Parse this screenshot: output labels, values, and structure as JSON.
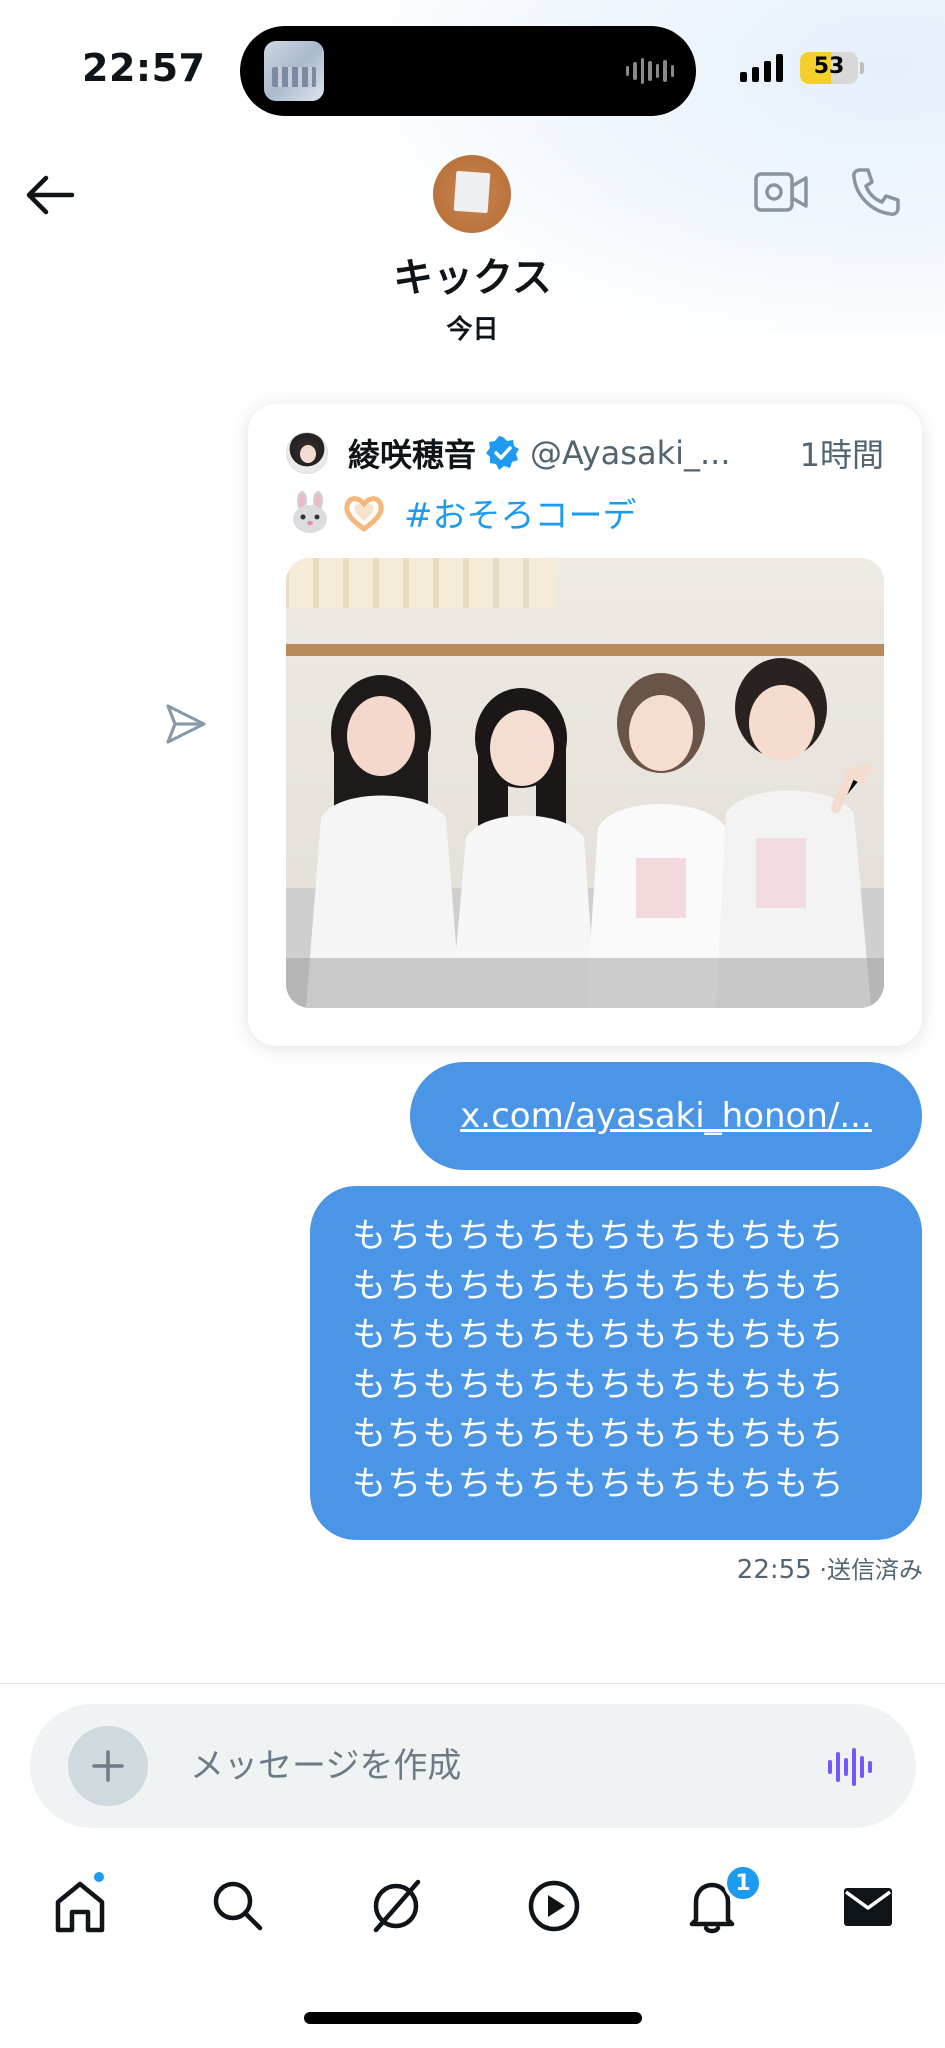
{
  "status_bar": {
    "time": "22:57",
    "battery_level": "53",
    "battery_fill_fraction": 0.53,
    "battery_color": "#f5cf2a"
  },
  "header": {
    "back_icon": "arrow-left-icon",
    "contact_name": "キックス",
    "subtitle": "今日",
    "video_icon": "video-camera-icon",
    "phone_icon": "phone-icon"
  },
  "conversation": {
    "shared_post": {
      "author_name": "綾咲穂音",
      "verified": true,
      "handle": "@Ayasaki_...",
      "time_ago": "1時間",
      "emoji": [
        "rabbit-emoji",
        "heart-hands-emoji"
      ],
      "hashtag": "#おそろコーデ"
    },
    "link_message": "x.com/ayasaki_honon/...",
    "text_message_lines": [
      "もちもちもちもちもちもちもち",
      "もちもちもちもちもちもちもち",
      "もちもちもちもちもちもちもち",
      "もちもちもちもちもちもちもち",
      "もちもちもちもちもちもちもち",
      "もちもちもちもちもちもちもち"
    ],
    "sent_time": "22:55",
    "sent_status": "·送信済み"
  },
  "composer": {
    "placeholder": "メッセージを作成",
    "add_icon": "plus-icon",
    "voice_icon": "voice-wave-icon"
  },
  "bottom_nav": {
    "items": [
      "home-icon",
      "search-icon",
      "grok-icon",
      "video-play-icon",
      "notifications-bell-icon",
      "messages-envelope-icon"
    ],
    "notifications_badge": "1"
  },
  "colors": {
    "bubble": "#4a95e6",
    "accent": "#1d9bf0",
    "voice": "#7856ff"
  }
}
